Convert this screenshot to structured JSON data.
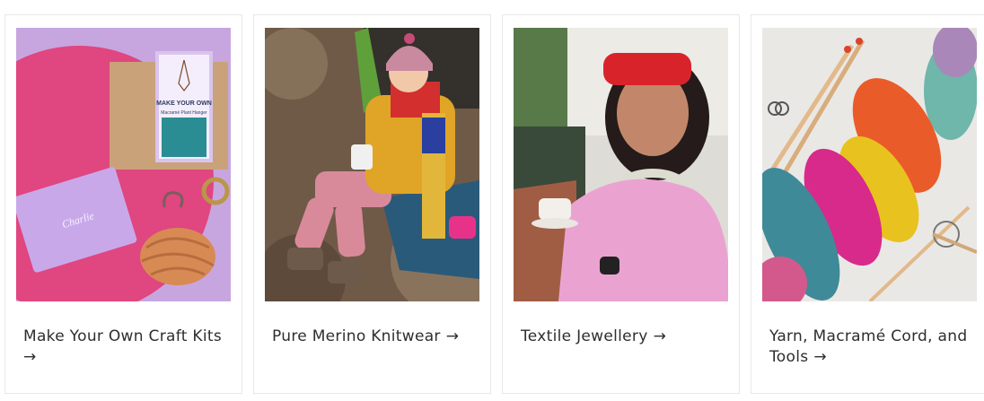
{
  "collections": [
    {
      "title": "Make Your Own Craft Kits",
      "arrow": "→",
      "image": "craft-kit-photo",
      "box_title": "MAKE YOUR OWN",
      "box_subtitle": "Macramé Plant Hanger"
    },
    {
      "title": "Pure Merino Knitwear",
      "arrow": "→",
      "image": "merino-knitwear-photo"
    },
    {
      "title": "Textile Jewellery",
      "arrow": "→",
      "image": "textile-jewellery-photo"
    },
    {
      "title": "Yarn, Macramé Cord, and Tools",
      "arrow": "→",
      "image": "yarn-tools-photo"
    }
  ]
}
